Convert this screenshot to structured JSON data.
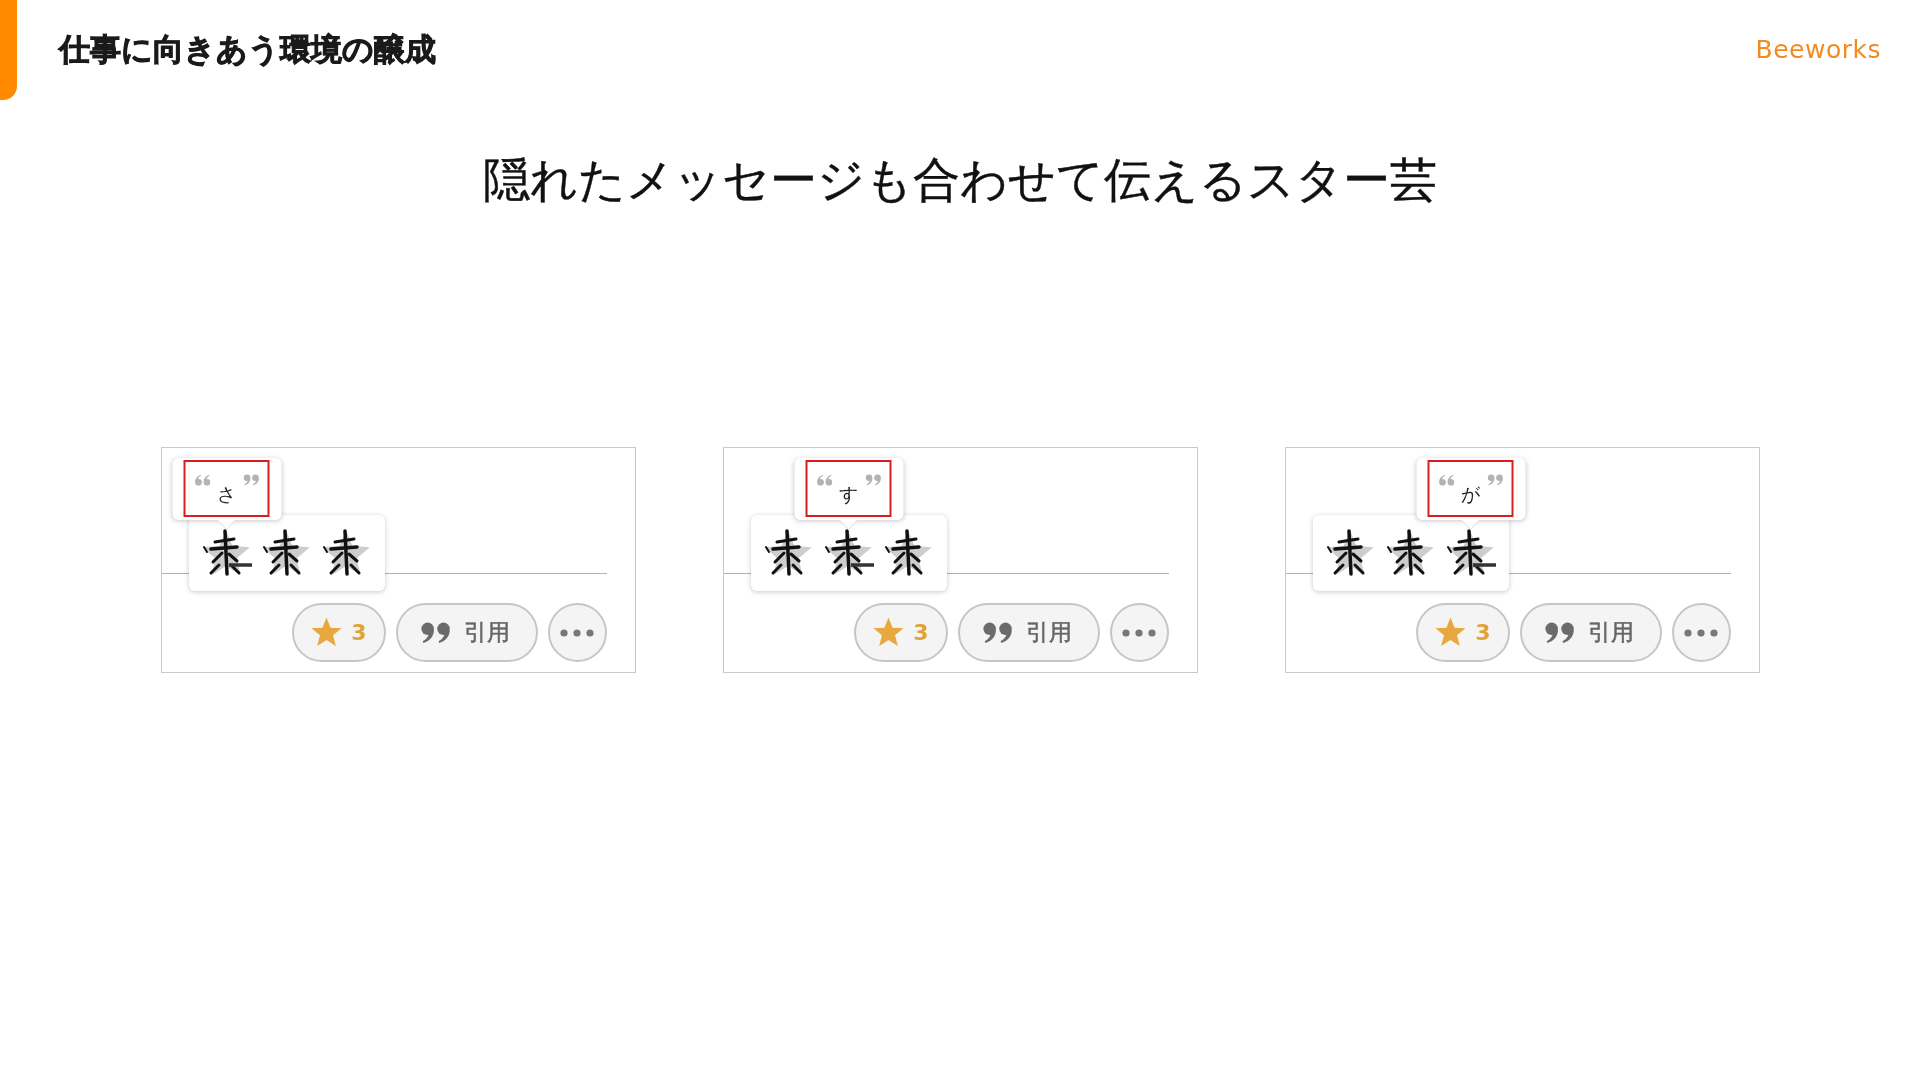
{
  "header": {
    "title": "仕事に向きあう環境の醸成",
    "brand": "Beeworks"
  },
  "heading": "隠れたメッセージも合わせて伝えるスター芸",
  "panels": [
    {
      "quote": "さ",
      "stars": [
        {
          "selected": true
        },
        {
          "selected": false
        },
        {
          "selected": false
        }
      ],
      "buttons": [
        {
          "kind": "star",
          "label": "3"
        },
        {
          "kind": "quote",
          "label": "引用"
        },
        {
          "kind": "more"
        }
      ]
    },
    {
      "quote": "す",
      "stars": [
        {
          "selected": false
        },
        {
          "selected": true
        },
        {
          "selected": false
        }
      ],
      "buttons": [
        {
          "kind": "star",
          "label": "3"
        },
        {
          "kind": "quote",
          "label": "引用"
        },
        {
          "kind": "more"
        }
      ]
    },
    {
      "quote": "が",
      "stars": [
        {
          "selected": false
        },
        {
          "selected": false
        },
        {
          "selected": true
        }
      ],
      "buttons": [
        {
          "kind": "star",
          "label": "3"
        },
        {
          "kind": "quote",
          "label": "引用"
        },
        {
          "kind": "more"
        }
      ]
    }
  ]
}
